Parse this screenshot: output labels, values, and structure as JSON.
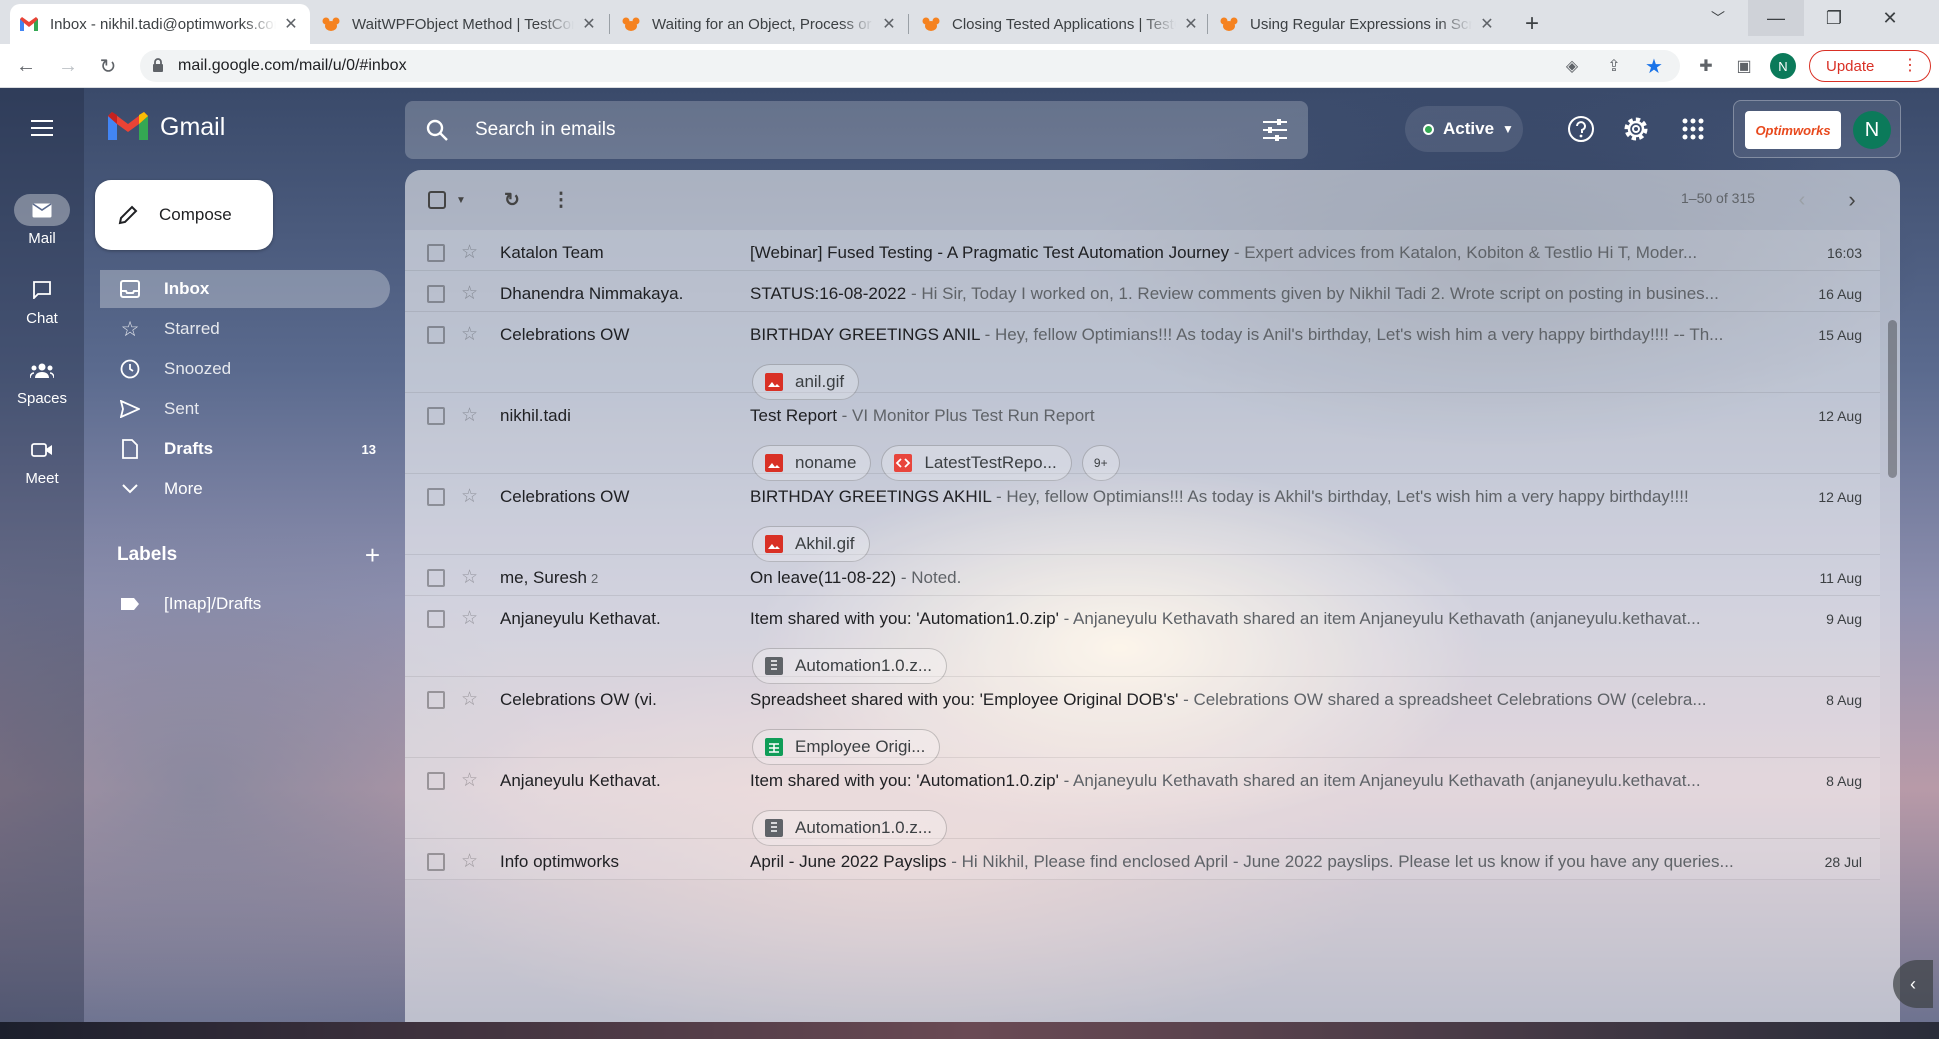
{
  "browser": {
    "tabs": [
      {
        "title": "Inbox - nikhil.tadi@optimworks.com",
        "icon": "gmail-icon"
      },
      {
        "title": "WaitWPFObject Method | TestComplete",
        "icon": "smartbear-icon"
      },
      {
        "title": "Waiting for an Object, Process or Window",
        "icon": "smartbear-icon"
      },
      {
        "title": "Closing Tested Applications | TestComplete",
        "icon": "smartbear-icon"
      },
      {
        "title": "Using Regular Expressions in Scripts",
        "icon": "smartbear-icon"
      }
    ],
    "url": "mail.google.com/mail/u/0/#inbox",
    "update_label": "Update",
    "profile_initial": "N"
  },
  "gmail": {
    "app_name": "Gmail",
    "rail": [
      {
        "label": "Mail",
        "icon": "mail-icon"
      },
      {
        "label": "Chat",
        "icon": "chat-icon"
      },
      {
        "label": "Spaces",
        "icon": "spaces-icon"
      },
      {
        "label": "Meet",
        "icon": "meet-icon"
      }
    ],
    "compose_label": "Compose",
    "nav": [
      {
        "label": "Inbox",
        "icon": "inbox-icon",
        "count": ""
      },
      {
        "label": "Starred",
        "icon": "star-icon",
        "count": ""
      },
      {
        "label": "Snoozed",
        "icon": "clock-icon",
        "count": ""
      },
      {
        "label": "Sent",
        "icon": "send-icon",
        "count": ""
      },
      {
        "label": "Drafts",
        "icon": "draft-icon",
        "count": "13"
      },
      {
        "label": "More",
        "icon": "chevron-down-icon",
        "count": ""
      }
    ],
    "labels_title": "Labels",
    "labels": [
      {
        "label": "[Imap]/Drafts",
        "icon": "label-icon"
      }
    ],
    "search_placeholder": "Search in emails",
    "status": "Active",
    "org_logo_text": "Optimworks",
    "avatar_initial": "N",
    "range": "1–50 of 315",
    "emails": [
      {
        "sender": "Katalon Team",
        "count": "",
        "subject": "[Webinar] Fused Testing - A Pragmatic Test Automation Journey",
        "snippet": " - Expert advices from Katalon, Kobiton & Testlio Hi T, Moder...",
        "date": "16:03",
        "attachments": []
      },
      {
        "sender": "Dhanendra Nimmakaya.",
        "count": "",
        "subject": "STATUS:16-08-2022",
        "snippet": " - Hi Sir, Today I worked on, 1. Review comments given by Nikhil Tadi 2. Wrote script on posting in busines...",
        "date": "16 Aug",
        "attachments": []
      },
      {
        "sender": "Celebrations OW",
        "count": "",
        "subject": "BIRTHDAY GREETINGS ANIL",
        "snippet": " - Hey, fellow Optimians!!! As today is Anil's birthday, Let's wish him a very happy birthday!!!! -- Th...",
        "date": "15 Aug",
        "attachments": [
          {
            "name": "anil.gif",
            "type": "image"
          }
        ]
      },
      {
        "sender": "nikhil.tadi",
        "count": "",
        "subject": "Test Report",
        "snippet": " - VI Monitor Plus Test Run Report",
        "date": "12 Aug",
        "attachments": [
          {
            "name": "noname",
            "type": "image"
          },
          {
            "name": "LatestTestRepo...",
            "type": "code"
          },
          {
            "name": "9+",
            "type": "more"
          }
        ]
      },
      {
        "sender": "Celebrations OW",
        "count": "",
        "subject": "BIRTHDAY GREETINGS AKHIL",
        "snippet": " - Hey, fellow Optimians!!! As today is Akhil's birthday, Let's wish him a very happy birthday!!!!",
        "date": "12 Aug",
        "attachments": [
          {
            "name": "Akhil.gif",
            "type": "image"
          }
        ]
      },
      {
        "sender": "me, Suresh",
        "count": "2",
        "subject": "On leave(11-08-22)",
        "snippet": " - Noted.",
        "date": "11 Aug",
        "attachments": []
      },
      {
        "sender": "Anjaneyulu Kethavat.",
        "count": "",
        "subject": "Item shared with you: 'Automation1.0.zip'",
        "snippet": " - Anjaneyulu Kethavath shared an item Anjaneyulu Kethavath (anjaneyulu.kethavat...",
        "date": "9 Aug",
        "attachments": [
          {
            "name": "Automation1.0.z...",
            "type": "zip"
          }
        ]
      },
      {
        "sender": "Celebrations OW (vi.",
        "count": "",
        "subject": "Spreadsheet shared with you: 'Employee Original DOB's'",
        "snippet": " - Celebrations OW shared a spreadsheet Celebrations OW (celebra...",
        "date": "8 Aug",
        "attachments": [
          {
            "name": "Employee Origi...",
            "type": "sheet"
          }
        ]
      },
      {
        "sender": "Anjaneyulu Kethavat.",
        "count": "",
        "subject": "Item shared with you: 'Automation1.0.zip'",
        "snippet": " - Anjaneyulu Kethavath shared an item Anjaneyulu Kethavath (anjaneyulu.kethavat...",
        "date": "8 Aug",
        "attachments": [
          {
            "name": "Automation1.0.z...",
            "type": "zip"
          }
        ]
      },
      {
        "sender": "Info optimworks",
        "count": "",
        "subject": "April - June 2022 Payslips",
        "snippet": " - Hi Nikhil, Please find enclosed April - June 2022 payslips. Please let us know if you have any queries...",
        "date": "28 Jul",
        "attachments": []
      }
    ]
  }
}
